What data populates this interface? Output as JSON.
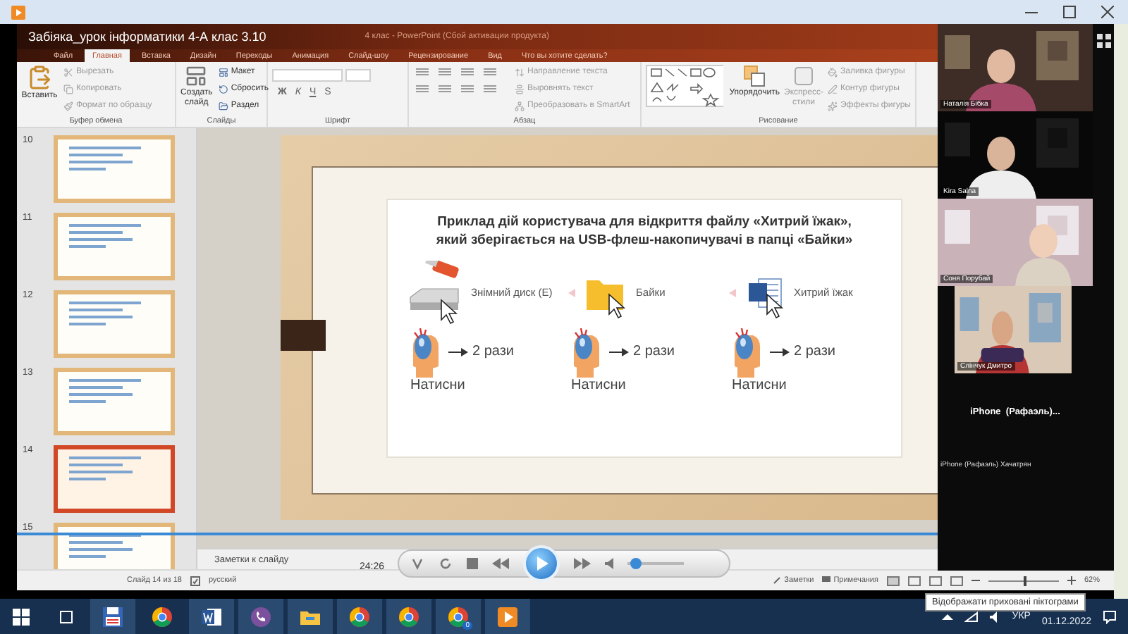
{
  "window": {
    "title": "Забіяка_урок інформатики 4-А клас 3.10",
    "app_title": "4 клас - PowerPoint (Сбой активации продукта)"
  },
  "ribbon_tabs": [
    {
      "label": "Файл",
      "selected": false
    },
    {
      "label": "Главная",
      "selected": true
    },
    {
      "label": "Вставка",
      "selected": false
    },
    {
      "label": "Дизайн",
      "selected": false
    },
    {
      "label": "Переходы",
      "selected": false
    },
    {
      "label": "Анимация",
      "selected": false
    },
    {
      "label": "Слайд-шоу",
      "selected": false
    },
    {
      "label": "Рецензирование",
      "selected": false
    },
    {
      "label": "Вид",
      "selected": false
    }
  ],
  "tell_me": "Что вы хотите сделать?",
  "ribbon_groups": [
    {
      "name": "Буфер обмена",
      "kind": "clipboard",
      "big": "Вставить",
      "items": [
        {
          "label": "Вырезать",
          "disabled": true
        },
        {
          "label": "Копировать",
          "disabled": true
        },
        {
          "label": "Формат по образцу",
          "disabled": true
        }
      ]
    },
    {
      "name": "Слайды",
      "kind": "slides",
      "big": "Создать слайд",
      "items": [
        {
          "label": "Макет",
          "disabled": false
        },
        {
          "label": "Сбросить",
          "disabled": false
        },
        {
          "label": "Раздел",
          "disabled": false
        }
      ]
    },
    {
      "name": "Шрифт",
      "kind": "font",
      "format_buttons": [
        "Ж",
        "К",
        "Ч",
        "S"
      ]
    },
    {
      "name": "Абзац",
      "kind": "paragraph",
      "items": [
        {
          "label": "Направление текста",
          "disabled": true
        },
        {
          "label": "Выровнять текст",
          "disabled": true
        },
        {
          "label": "Преобразовать в SmartArt",
          "disabled": true
        }
      ]
    },
    {
      "name": "Рисование",
      "kind": "drawing",
      "big": "Упорядочить",
      "big2": "Экспресс-стили",
      "items": [
        {
          "label": "Заливка фигуры",
          "disabled": true
        },
        {
          "label": "Контур фигуры",
          "disabled": true
        },
        {
          "label": "Эффекты фигуры",
          "disabled": true
        }
      ]
    }
  ],
  "thumbnails": [
    {
      "number": "10",
      "selected": false
    },
    {
      "number": "11",
      "selected": false
    },
    {
      "number": "12",
      "selected": false
    },
    {
      "number": "13",
      "selected": false
    },
    {
      "number": "14",
      "selected": true
    },
    {
      "number": "15",
      "selected": false
    }
  ],
  "slide": {
    "heading_lines": [
      "Приклад дій користувача для відкриття файлу «Хитрий їжак»,",
      "який зберігається на USB-флеш-накопичувачі в папці «Байки»"
    ],
    "steps": [
      {
        "kind": "drive",
        "label": "Знімний диск (E)",
        "count": "2 рази",
        "action": "Натисни"
      },
      {
        "kind": "folder",
        "label": "Байки",
        "count": "2 рази",
        "action": "Натисни"
      },
      {
        "kind": "document",
        "label": "Хитрий їжак",
        "count": "2 рази",
        "action": "Натисни"
      }
    ]
  },
  "notes": "Заметки к слайду",
  "player": {
    "time": "24:26",
    "seek": {
      "level": 1
    },
    "volume": {
      "level": 0.15
    }
  },
  "status": {
    "slide": "Слайд 14 из 18",
    "language": "русский",
    "notes": "Заметки",
    "comments": "Примечания",
    "zoom": "62%",
    "zoom_slider": {
      "level": 0.5
    }
  },
  "participants": [
    {
      "name": "Наталія Бібка",
      "kind": "video"
    },
    {
      "name": "Kira Salna",
      "kind": "video"
    },
    {
      "name": "Соня Порубай",
      "kind": "video"
    },
    {
      "name": "Слінчук Дмитро",
      "kind": "video"
    },
    {
      "name": "iPhone (Рафаэль) Хачатрян",
      "kind": "placeholder",
      "label": "iPhone  (Рафаэль)..."
    }
  ],
  "taskbar": {
    "apps": [
      {
        "kind": "floppy",
        "open": true
      },
      {
        "kind": "chrome",
        "open": false
      },
      {
        "kind": "word",
        "open": true
      },
      {
        "kind": "viber",
        "open": true
      },
      {
        "kind": "explorer",
        "open": true
      },
      {
        "kind": "chrome",
        "open": true
      },
      {
        "kind": "chrome",
        "open": true
      },
      {
        "kind": "chrome",
        "open": true,
        "badge": "0"
      },
      {
        "kind": "player",
        "open": true
      }
    ],
    "language": "УКР",
    "date": "01.12.2022",
    "tooltip": "Відображати приховані піктограми"
  }
}
